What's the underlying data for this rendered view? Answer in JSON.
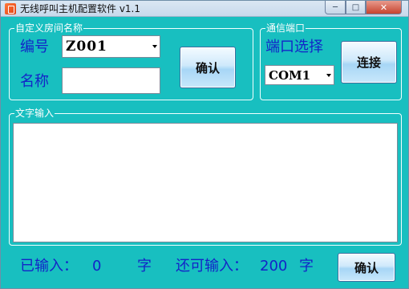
{
  "window": {
    "title": "无线呼叫主机配置软件 v1.1",
    "icon": "app-icon",
    "controls": {
      "minimize": "─",
      "maximize": "□",
      "close": "✕"
    }
  },
  "room_group": {
    "legend": "自定义房间名称",
    "number_label": "编号",
    "number_value": "Z001",
    "name_label": "名称",
    "name_value": "",
    "confirm_label": "确认"
  },
  "comm_group": {
    "legend": "通信端口",
    "port_label": "端口选择",
    "port_value": "COM1",
    "connect_label": "连接"
  },
  "text_group": {
    "legend": "文字输入",
    "content": ""
  },
  "status": {
    "entered_label": "已输入：",
    "entered_count": "0",
    "unit1": "字",
    "remaining_label": "还可输入：",
    "remaining_count": "200",
    "unit2": "字",
    "confirm_label": "确认"
  },
  "colors": {
    "background": "#18bfc0",
    "label_text": "#1324c8"
  }
}
